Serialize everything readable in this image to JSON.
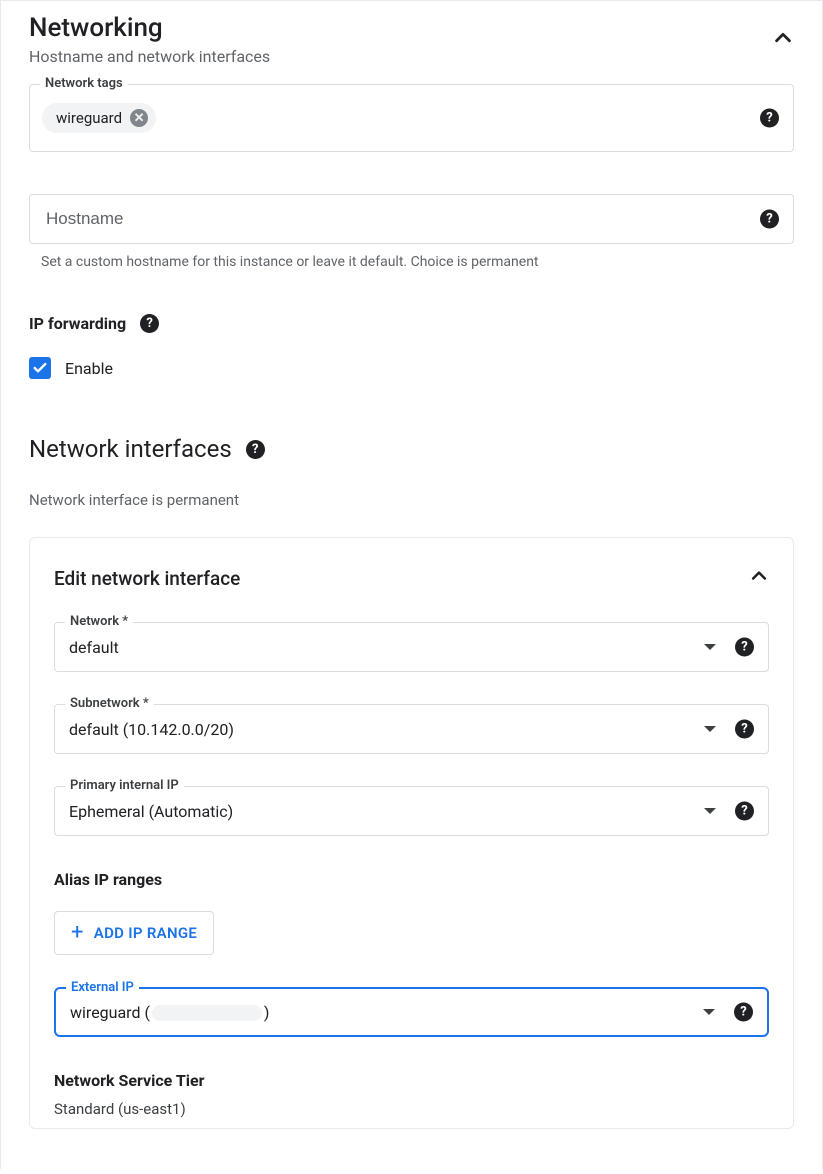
{
  "section": {
    "title": "Networking",
    "subtitle": "Hostname and network interfaces"
  },
  "network_tags": {
    "label": "Network tags",
    "chips": [
      "wireguard"
    ]
  },
  "hostname": {
    "placeholder": "Hostname",
    "helper": "Set a custom hostname for this instance or leave it default. Choice is permanent"
  },
  "ip_forwarding": {
    "label": "IP forwarding",
    "enable_label": "Enable",
    "enabled": true
  },
  "interfaces": {
    "heading": "Network interfaces",
    "permanent_text": "Network interface is permanent",
    "card": {
      "title": "Edit network interface",
      "network": {
        "label": "Network *",
        "value": "default"
      },
      "subnetwork": {
        "label": "Subnetwork *",
        "value": "default (10.142.0.0/20)"
      },
      "primary_ip": {
        "label": "Primary internal IP",
        "value": "Ephemeral (Automatic)"
      },
      "alias": {
        "label": "Alias IP ranges",
        "add_button": "ADD IP RANGE"
      },
      "external_ip": {
        "label": "External IP",
        "value_prefix": "wireguard (",
        "value_suffix": ")"
      },
      "tier": {
        "label": "Network Service Tier",
        "value": "Standard (us-east1)"
      }
    }
  }
}
